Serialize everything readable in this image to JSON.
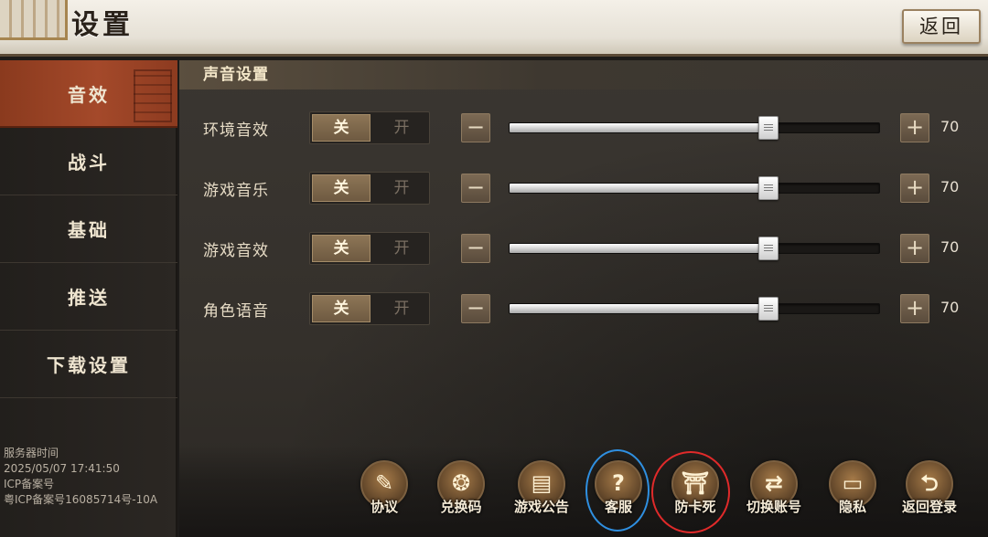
{
  "title": "设置",
  "back_label": "返回",
  "sidebar": {
    "items": [
      {
        "label": "音效"
      },
      {
        "label": "战斗"
      },
      {
        "label": "基础"
      },
      {
        "label": "推送"
      },
      {
        "label": "下载设置"
      }
    ],
    "active_index": 0
  },
  "server_info": {
    "time_label": "服务器时间",
    "time_value": "2025/05/07  17:41:50",
    "icp_label": "ICP备案号",
    "icp_value": "粤ICP备案号16085714号-10A"
  },
  "section": {
    "title": "声音设置"
  },
  "sound_rows": [
    {
      "label": "环境音效",
      "off_label": "关",
      "on_label": "开",
      "selected": "关",
      "value": 70
    },
    {
      "label": "游戏音乐",
      "off_label": "关",
      "on_label": "开",
      "selected": "关",
      "value": 70
    },
    {
      "label": "游戏音效",
      "off_label": "关",
      "on_label": "开",
      "selected": "关",
      "value": 70
    },
    {
      "label": "角色语音",
      "off_label": "关",
      "on_label": "开",
      "selected": "关",
      "value": 70
    }
  ],
  "slider": {
    "minus": "−",
    "plus": "+"
  },
  "bottom_bar": [
    {
      "label": "协议",
      "icon": "scroll-icon",
      "glyph": "✎"
    },
    {
      "label": "兑换码",
      "icon": "pouch-icon",
      "glyph": "❂"
    },
    {
      "label": "游戏公告",
      "icon": "board-icon",
      "glyph": "▤"
    },
    {
      "label": "客服",
      "icon": "help-icon",
      "glyph": "?"
    },
    {
      "label": "防卡死",
      "icon": "gate-icon",
      "glyph": "⛩"
    },
    {
      "label": "切换账号",
      "icon": "switch-icon",
      "glyph": "⇄"
    },
    {
      "label": "隐私",
      "icon": "shield-icon",
      "glyph": "▭"
    },
    {
      "label": "返回登录",
      "icon": "return-icon",
      "glyph": "⮌"
    }
  ],
  "colors": {
    "accent": "#a4492a",
    "highlight_blue": "#2f8fe0",
    "highlight_red": "#e02a2a"
  }
}
